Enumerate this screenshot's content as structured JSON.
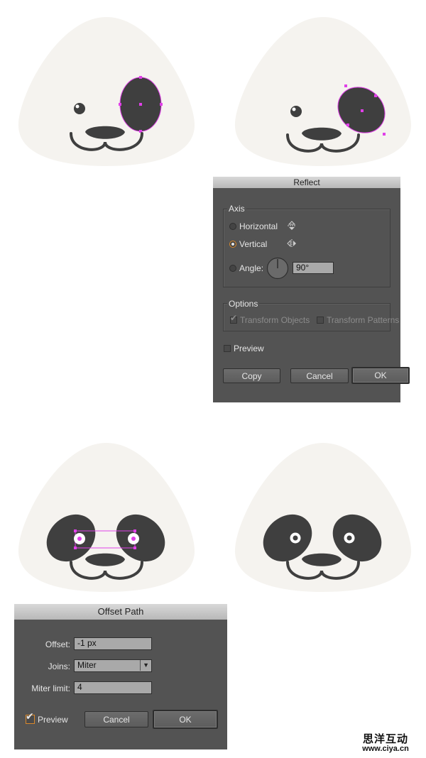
{
  "reflect_dialog": {
    "title": "Reflect",
    "axis_legend": "Axis",
    "horizontal_label": "Horizontal",
    "vertical_label": "Vertical",
    "angle_label": "Angle:",
    "angle_value": "90°",
    "options_legend": "Options",
    "transform_objects_label": "Transform Objects",
    "transform_patterns_label": "Transform Patterns",
    "preview_label": "Preview",
    "copy_label": "Copy",
    "cancel_label": "Cancel",
    "ok_label": "OK"
  },
  "offset_dialog": {
    "title": "Offset Path",
    "offset_label": "Offset:",
    "offset_value": "-1 px",
    "joins_label": "Joins:",
    "joins_value": "Miter",
    "miter_label": "Miter limit:",
    "miter_value": "4",
    "preview_label": "Preview",
    "cancel_label": "Cancel",
    "ok_label": "OK"
  },
  "watermark": {
    "chinese": "思洋互动",
    "url": "www.ciya.cn"
  },
  "colors": {
    "face": "#f5f3ef",
    "patch": "#3f3f3f",
    "selection": "#e040e8",
    "dialog_bg": "#535353",
    "accent": "#d9882b"
  }
}
